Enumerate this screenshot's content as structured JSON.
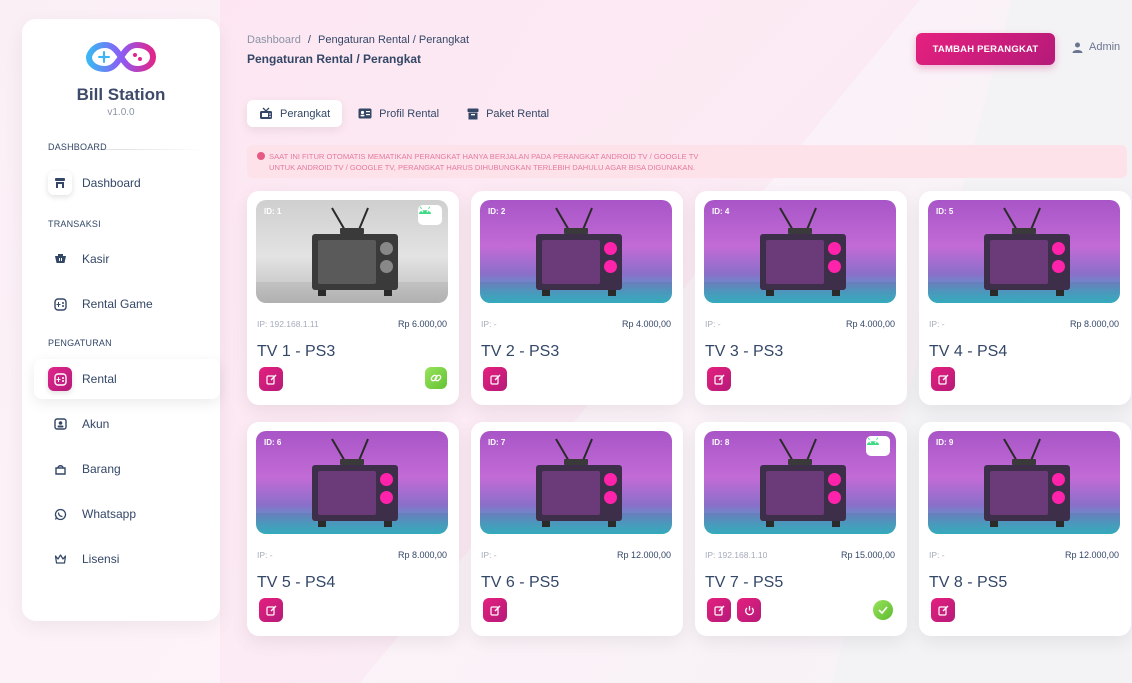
{
  "app": {
    "brand": "Bill Station",
    "version": "v1.0.0"
  },
  "sidebar": {
    "sections": [
      {
        "label": "DASHBOARD"
      },
      {
        "label": "TRANSAKSI"
      },
      {
        "label": "PENGATURAN"
      }
    ],
    "items": [
      {
        "label": "Dashboard",
        "icon": "shop-icon"
      },
      {
        "label": "Kasir",
        "icon": "basket-icon"
      },
      {
        "label": "Rental Game",
        "icon": "gamepad-icon"
      },
      {
        "label": "Rental",
        "icon": "gamepad-icon",
        "active": true
      },
      {
        "label": "Akun",
        "icon": "user-card-icon"
      },
      {
        "label": "Barang",
        "icon": "box-icon"
      },
      {
        "label": "Whatsapp",
        "icon": "whatsapp-icon"
      },
      {
        "label": "Lisensi",
        "icon": "crown-icon"
      }
    ]
  },
  "header": {
    "breadcrumb_root": "Dashboard",
    "breadcrumb_sep": "/",
    "breadcrumb_current": "Pengaturan Rental / Perangkat",
    "title": "Pengaturan Rental / Perangkat",
    "add_button": "TAMBAH PERANGKAT",
    "user": "Admin"
  },
  "tabs": [
    {
      "label": "Perangkat",
      "icon": "tv-icon",
      "active": true
    },
    {
      "label": "Profil Rental",
      "icon": "id-card-icon"
    },
    {
      "label": "Paket Rental",
      "icon": "package-icon"
    }
  ],
  "alert": {
    "line1": "SAAT INI FITUR OTOMATIS MEMATIKAN PERANGKAT HANYA BERJALAN PADA PERANGKAT ANDROID TV / GOOGLE TV",
    "line2": "UNTUK ANDROID TV / GOOGLE TV, PERANGKAT HARUS DIHUBUNGKAN TERLEBIH DAHULU AGAR BISA DIGUNAKAN."
  },
  "devices": [
    {
      "id": "ID: 1",
      "ip": "IP: 192.168.1.11",
      "price": "Rp 6.000,00",
      "name": "TV 1 - PS3"
    },
    {
      "id": "ID: 2",
      "ip": "IP: -",
      "price": "Rp 4.000,00",
      "name": "TV 2 - PS3"
    },
    {
      "id": "ID: 4",
      "ip": "IP: -",
      "price": "Rp 4.000,00",
      "name": "TV 3 - PS3"
    },
    {
      "id": "ID: 5",
      "ip": "IP: -",
      "price": "Rp 8.000,00",
      "name": "TV 4 - PS4"
    },
    {
      "id": "ID: 6",
      "ip": "IP: -",
      "price": "Rp 8.000,00",
      "name": "TV 5 - PS4"
    },
    {
      "id": "ID: 7",
      "ip": "IP: -",
      "price": "Rp 12.000,00",
      "name": "TV 6 - PS5"
    },
    {
      "id": "ID: 8",
      "ip": "IP: 192.168.1.10",
      "price": "Rp 15.000,00",
      "name": "TV 7 - PS5"
    },
    {
      "id": "ID: 9",
      "ip": "IP: -",
      "price": "Rp 12.000,00",
      "name": "TV 8 - PS5"
    }
  ],
  "colors": {
    "accent": "#d6217f",
    "accent_dark": "#b51a7a",
    "success": "#6cc83b",
    "alert_bg": "#fde2ea",
    "alert_text": "#e57aa0"
  }
}
